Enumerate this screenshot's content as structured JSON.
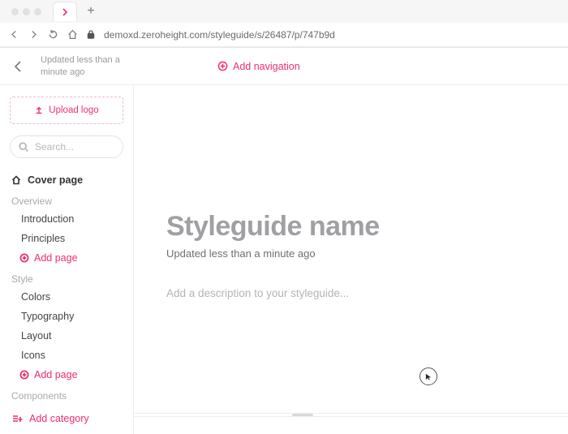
{
  "browser": {
    "url": "demoxd.zeroheight.com/styleguide/s/26487/p/747b9d"
  },
  "header": {
    "updated_text": "Updated less than a minute ago",
    "add_nav_label": "Add navigation"
  },
  "sidebar": {
    "upload_label": "Upload logo",
    "search_placeholder": "Search...",
    "cover_label": "Cover page",
    "sections": [
      {
        "label": "Overview",
        "items": [
          "Introduction",
          "Principles"
        ],
        "add_label": "Add page"
      },
      {
        "label": "Style",
        "items": [
          "Colors",
          "Typography",
          "Layout",
          "Icons"
        ],
        "add_label": "Add page"
      },
      {
        "label": "Components",
        "items": [],
        "add_label": null
      }
    ],
    "add_category_label": "Add category"
  },
  "main": {
    "title": "Styleguide name",
    "subtitle": "Updated less than a minute ago",
    "description_placeholder": "Add a description to your styleguide..."
  },
  "colors": {
    "accent": "#ef2f6b"
  }
}
